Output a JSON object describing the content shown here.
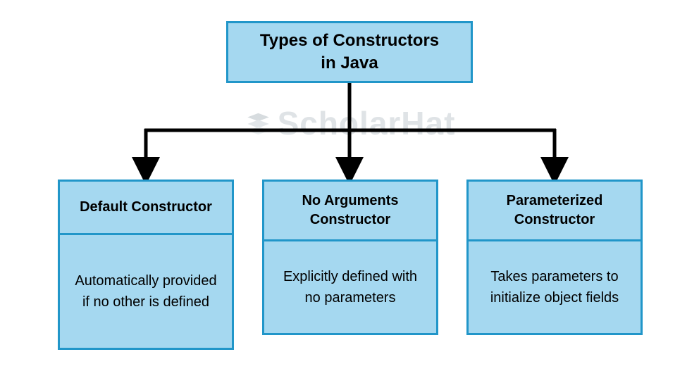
{
  "diagram": {
    "root": {
      "title_line1": "Types of Constructors",
      "title_line2": "in Java"
    },
    "children": [
      {
        "title": "Default Constructor",
        "description": "Automatically provided if no other is defined"
      },
      {
        "title": "No Arguments Constructor",
        "description": "Explicitly defined with no parameters"
      },
      {
        "title": "Parameterized Constructor",
        "description": "Takes parameters to initialize object fields"
      }
    ],
    "watermark": "ScholarHat",
    "colors": {
      "box_fill": "#a5d8f0",
      "box_border": "#2196c9",
      "connector": "#000000",
      "watermark": "#dfe3e6"
    }
  }
}
